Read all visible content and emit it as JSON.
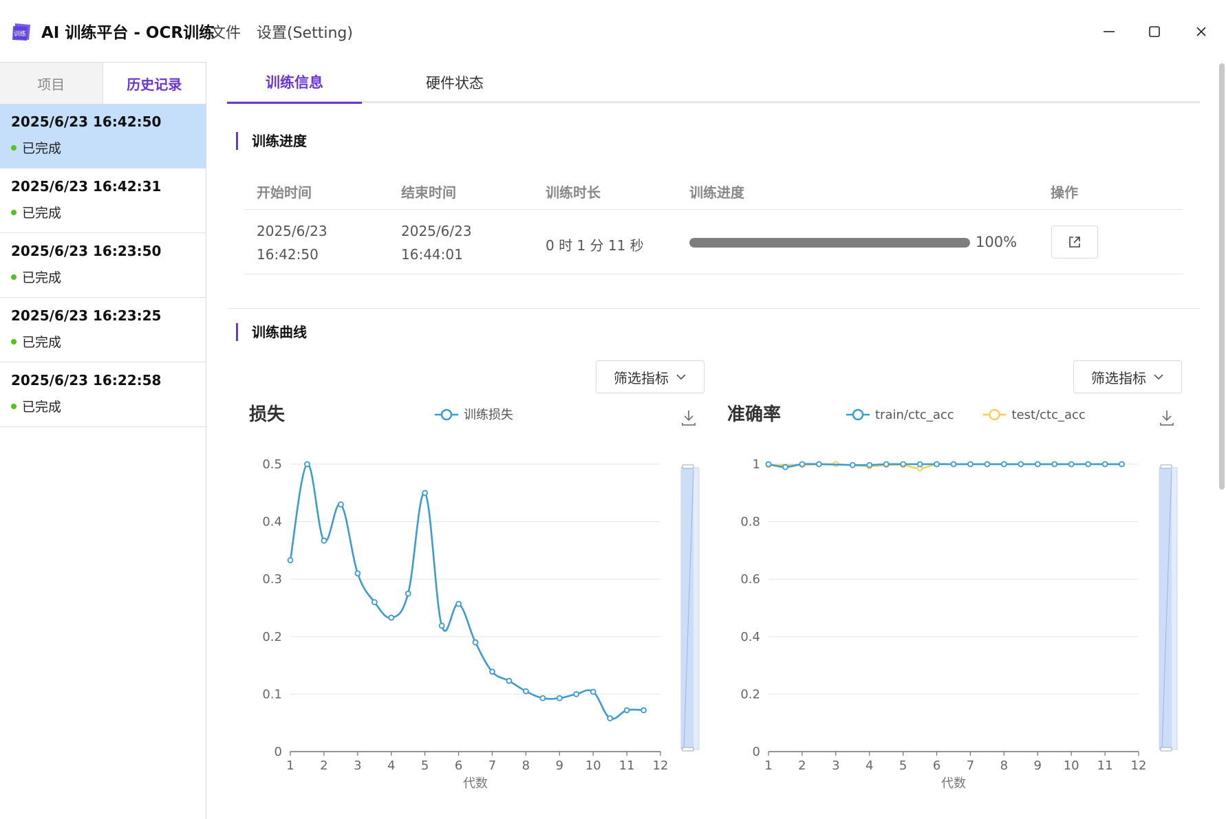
{
  "app": {
    "title": "AI 训练平台 - OCR训练",
    "menu": [
      "文件",
      "设置(Setting)"
    ],
    "logo_text": "训练"
  },
  "sidebar": {
    "tabs": [
      {
        "label": "项目",
        "active": false
      },
      {
        "label": "历史记录",
        "active": true
      }
    ],
    "items": [
      {
        "time": "2025/6/23 16:42:50",
        "status": "已完成",
        "selected": true
      },
      {
        "time": "2025/6/23 16:42:31",
        "status": "已完成",
        "selected": false
      },
      {
        "time": "2025/6/23 16:23:50",
        "status": "已完成",
        "selected": false
      },
      {
        "time": "2025/6/23 16:23:25",
        "status": "已完成",
        "selected": false
      },
      {
        "time": "2025/6/23 16:22:58",
        "status": "已完成",
        "selected": false
      }
    ]
  },
  "main_tabs": [
    {
      "label": "训练信息",
      "active": true
    },
    {
      "label": "硬件状态",
      "active": false
    }
  ],
  "progress_section": {
    "title": "训练进度",
    "headers": [
      "开始时间",
      "结束时间",
      "训练时长",
      "训练进度",
      "操作"
    ],
    "row": {
      "start_date": "2025/6/23",
      "start_time": "16:42:50",
      "end_date": "2025/6/23",
      "end_time": "16:44:01",
      "duration": "0 时 1 分 11 秒",
      "progress": 1.0,
      "progress_label": "100%"
    }
  },
  "curve_section": {
    "title": "训练曲线",
    "filter_label": "筛选指标"
  },
  "colors": {
    "accent": "#6a35d9",
    "train_series": "#3a9bd5",
    "test_series": "#f7d154",
    "status_ok": "#52c41a"
  },
  "chart_data": [
    {
      "type": "line",
      "title": "损失",
      "xlabel": "代数",
      "ylabel": "",
      "xlim": [
        1,
        12
      ],
      "ylim": [
        0,
        0.5
      ],
      "yticks": [
        "0",
        "0.1",
        "0.2",
        "0.3",
        "0.4",
        "0.5"
      ],
      "xticks": [
        "1",
        "2",
        "3",
        "4",
        "5",
        "6",
        "7",
        "8",
        "9",
        "10",
        "11",
        "12"
      ],
      "grid": true,
      "legend": "top-center",
      "series": [
        {
          "name": "训练损失",
          "x": [
            1,
            1.5,
            2,
            2.5,
            3,
            3.5,
            4,
            4.5,
            5,
            5.5,
            6,
            6.5,
            7,
            7.5,
            8,
            8.5,
            9,
            9.5,
            10,
            10.5,
            11,
            11.5
          ],
          "values": [
            0.333,
            0.5,
            0.367,
            0.43,
            0.31,
            0.26,
            0.233,
            0.275,
            0.45,
            0.219,
            0.257,
            0.19,
            0.139,
            0.123,
            0.105,
            0.093,
            0.093,
            0.1,
            0.104,
            0.058,
            0.072,
            0.072
          ]
        }
      ]
    },
    {
      "type": "line",
      "title": "准确率",
      "xlabel": "代数",
      "ylabel": "",
      "xlim": [
        1,
        12
      ],
      "ylim": [
        0,
        1
      ],
      "yticks": [
        "0",
        "0.2",
        "0.4",
        "0.6",
        "0.8",
        "1"
      ],
      "xticks": [
        "1",
        "2",
        "3",
        "4",
        "5",
        "6",
        "7",
        "8",
        "9",
        "10",
        "11",
        "12"
      ],
      "grid": true,
      "legend": "top-center",
      "series": [
        {
          "name": "train/ctc_acc",
          "x": [
            1,
            1.5,
            2,
            2.5,
            3.5,
            4,
            4.5,
            5,
            5.5,
            6,
            6.5,
            7,
            7.5,
            8,
            8.5,
            9,
            9.5,
            10,
            10.5,
            11,
            11.5
          ],
          "values": [
            1.0,
            0.99,
            1.0,
            1.0,
            0.997,
            0.997,
            1.0,
            1.0,
            1.0,
            1.0,
            1.0,
            1.0,
            1.0,
            1.0,
            1.0,
            1.0,
            1.0,
            1.0,
            1.0,
            1.0,
            1.0
          ]
        },
        {
          "name": "test/ctc_acc",
          "x": [
            1,
            2,
            2.5,
            3,
            4,
            4.5,
            5,
            5.5,
            6,
            6.5,
            7,
            7.5,
            8,
            8.5,
            9,
            9.5,
            10,
            10.5,
            11,
            11.5
          ],
          "values": [
            0.997,
            0.997,
            1.0,
            1.0,
            0.993,
            0.997,
            0.997,
            0.985,
            1.0,
            1.0,
            1.0,
            1.0,
            1.0,
            1.0,
            1.0,
            1.0,
            1.0,
            1.0,
            1.0,
            1.0
          ]
        }
      ]
    }
  ]
}
